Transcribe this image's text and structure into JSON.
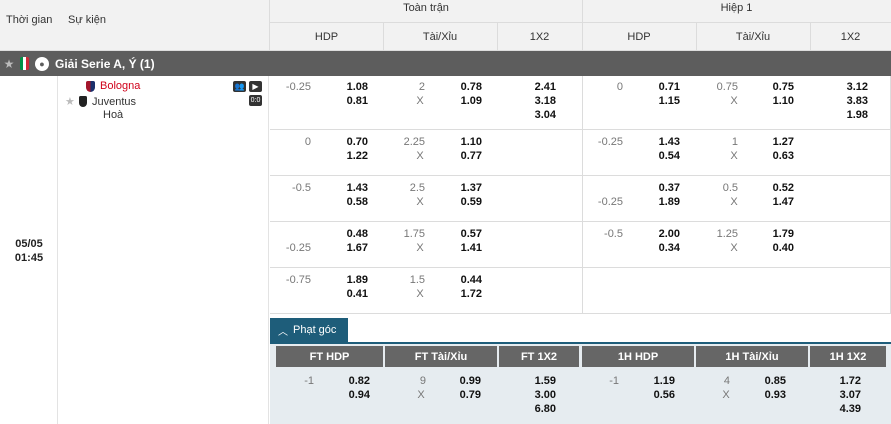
{
  "header": {
    "time": "Thời gian",
    "event": "Sự kiện",
    "full_match": "Toàn trận",
    "half1": "Hiệp 1",
    "hdp": "HDP",
    "ou": "Tài/Xỉu",
    "x12": "1X2"
  },
  "league": {
    "name": "Giải Serie A, Ý (1)",
    "flag_colors": [
      "#009246",
      "#ffffff",
      "#ce2b37"
    ]
  },
  "match": {
    "date": "05/05",
    "time": "01:45",
    "home": "Bologna",
    "away": "Juventus",
    "draw": "Hoà",
    "star": "★",
    "icon_a": "👥",
    "icon_b": "▶",
    "icon_c": "0:0"
  },
  "rows": [
    {
      "ft_hdp": [
        "-0.25",
        "",
        "1.08",
        "0.81"
      ],
      "ft_ou": [
        "2",
        "X",
        "0.78",
        "1.09"
      ],
      "ft_1x2": [
        "2.41",
        "3.18",
        "3.04"
      ],
      "h1_hdp": [
        "0",
        "",
        "0.71",
        "1.15"
      ],
      "h1_ou": [
        "0.75",
        "X",
        "0.75",
        "1.10"
      ],
      "h1_1x2": [
        "3.12",
        "3.83",
        "1.98"
      ]
    },
    {
      "ft_hdp": [
        "0",
        "",
        "0.70",
        "1.22"
      ],
      "ft_ou": [
        "2.25",
        "X",
        "1.10",
        "0.77"
      ],
      "ft_1x2": [
        "",
        "",
        ""
      ],
      "h1_hdp": [
        "-0.25",
        "",
        "1.43",
        "0.54"
      ],
      "h1_ou": [
        "1",
        "X",
        "1.27",
        "0.63"
      ],
      "h1_1x2": [
        "",
        "",
        ""
      ]
    },
    {
      "ft_hdp": [
        "-0.5",
        "",
        "1.43",
        "0.58"
      ],
      "ft_ou": [
        "2.5",
        "X",
        "1.37",
        "0.59"
      ],
      "ft_1x2": [
        "",
        "",
        ""
      ],
      "h1_hdp": [
        "",
        "-0.25",
        "0.37",
        "1.89"
      ],
      "h1_ou": [
        "0.5",
        "X",
        "0.52",
        "1.47"
      ],
      "h1_1x2": [
        "",
        "",
        ""
      ]
    },
    {
      "ft_hdp": [
        "",
        "-0.25",
        "0.48",
        "1.67"
      ],
      "ft_ou": [
        "1.75",
        "X",
        "0.57",
        "1.41"
      ],
      "ft_1x2": [
        "",
        "",
        ""
      ],
      "h1_hdp": [
        "-0.5",
        "",
        "2.00",
        "0.34"
      ],
      "h1_ou": [
        "1.25",
        "X",
        "1.79",
        "0.40"
      ],
      "h1_1x2": [
        "",
        "",
        ""
      ]
    },
    {
      "ft_hdp": [
        "-0.75",
        "",
        "1.89",
        "0.41"
      ],
      "ft_ou": [
        "1.5",
        "X",
        "0.44",
        "1.72"
      ],
      "ft_1x2": [
        "",
        "",
        ""
      ],
      "h1_hdp": [
        "",
        "",
        "",
        ""
      ],
      "h1_ou": [
        "",
        "",
        "",
        ""
      ],
      "h1_1x2": [
        "",
        "",
        ""
      ]
    }
  ],
  "corner": {
    "tab": "Phạt góc",
    "headers": [
      "FT HDP",
      "FT Tài/Xỉu",
      "FT 1X2",
      "1H HDP",
      "1H Tài/Xỉu",
      "1H 1X2"
    ],
    "ft_hdp": [
      "-1",
      "0.82",
      "0.94"
    ],
    "ft_ou": [
      "9",
      "X",
      "0.99",
      "0.79"
    ],
    "ft_1x2": [
      "1.59",
      "3.00",
      "6.80"
    ],
    "h1_hdp": [
      "-1",
      "1.19",
      "0.56"
    ],
    "h1_ou": [
      "4",
      "X",
      "0.85",
      "0.93"
    ],
    "h1_1x2": [
      "1.72",
      "3.07",
      "4.39"
    ]
  }
}
